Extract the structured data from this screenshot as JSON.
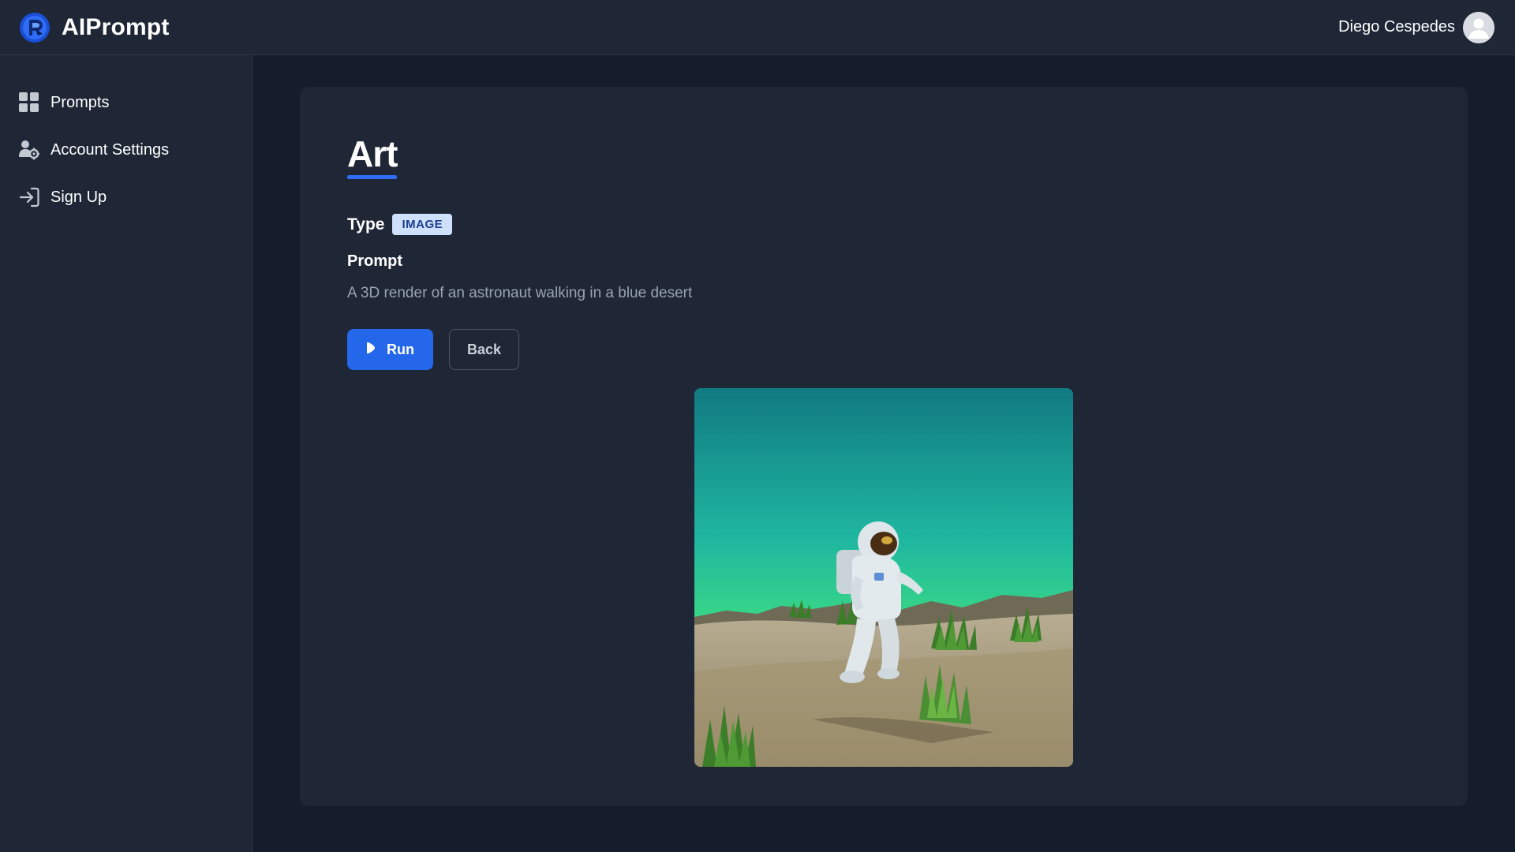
{
  "app": {
    "name": "AIPrompt",
    "logo_icon": "aiprompt-logo-icon",
    "brand_color": "#2467eb"
  },
  "user": {
    "name": "Diego Cespedes",
    "avatar_icon": "user-avatar-icon"
  },
  "sidebar": {
    "items": [
      {
        "label": "Prompts",
        "icon": "grid-icon"
      },
      {
        "label": "Account Settings",
        "icon": "user-gear-icon"
      },
      {
        "label": "Sign Up",
        "icon": "sign-in-icon"
      }
    ]
  },
  "prompt": {
    "title": "Art",
    "type_label": "Type",
    "type_value": "IMAGE",
    "prompt_label": "Prompt",
    "prompt_text": "A 3D render of an astronaut walking in a blue desert",
    "run_label": "Run",
    "back_label": "Back",
    "result_image": "astronaut-walking-in-desert-image"
  },
  "colors": {
    "background": "#151d2c",
    "surface": "#1f2737",
    "accent": "#2467eb",
    "badge_bg": "#cfe0fb",
    "badge_text": "#1c3f8f"
  }
}
